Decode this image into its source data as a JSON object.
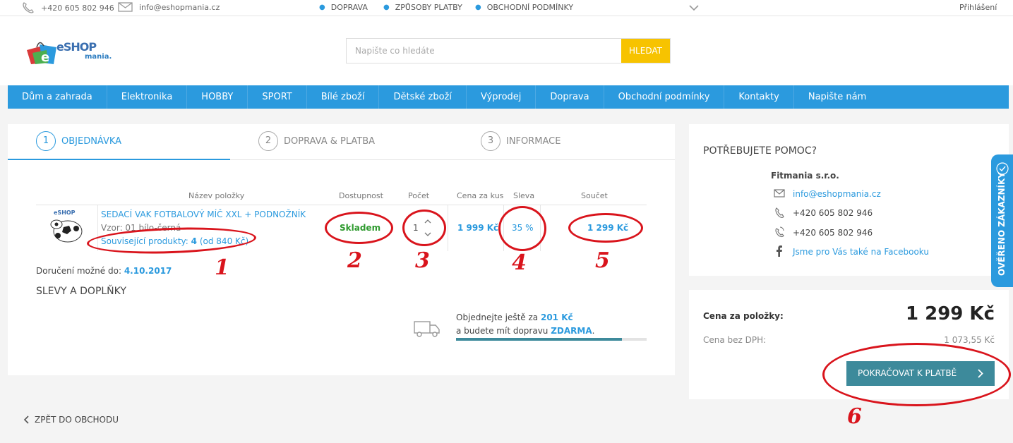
{
  "topbar": {
    "phone": "+420 605 802 946",
    "email": "info@eshopmania.cz",
    "nav": [
      "DOPRAVA",
      "ZPŮSOBY PLATBY",
      "OBCHODNÍ PODMÍNKY"
    ],
    "login": "Přihlášení"
  },
  "logo": {
    "text": "eSHOP",
    "sub": "mania."
  },
  "search": {
    "placeholder": "Napište co hledáte",
    "button": "HLEDAT"
  },
  "menu": [
    "Dům a zahrada",
    "Elektronika",
    "HOBBY",
    "SPORT",
    "Bílé zboží",
    "Dětské zboží",
    "Výprodej",
    "Doprava",
    "Obchodní podmínky",
    "Kontakty",
    "Napište nám"
  ],
  "steps": [
    {
      "n": "1",
      "label": "OBJEDNÁVKA"
    },
    {
      "n": "2",
      "label": "DOPRAVA & PLATBA"
    },
    {
      "n": "3",
      "label": "INFORMACE"
    }
  ],
  "table": {
    "headers": {
      "name": "Název položky",
      "availability": "Dostupnost",
      "count": "Počet",
      "unit_price": "Cena za kus",
      "discount": "Sleva",
      "total": "Součet"
    },
    "item": {
      "name": "SEDACÍ VAK FOTBALOVÝ MÍČ XXL + PODNOŽNÍK",
      "variant": "Vzor: 01 bílo-černá",
      "related_label": "Související produkty:",
      "related_count": "4",
      "related_from": "(od 840 Kč)",
      "availability": "Skladem",
      "quantity": "1",
      "unit_price": "1 999 Kč",
      "discount": "35 %",
      "total": "1 299 Kč"
    }
  },
  "delivery": {
    "label": "Doručení možné do:",
    "date": "4.10.2017"
  },
  "discounts_heading": "SLEVY A DOPLŇKY",
  "shipping": {
    "line1_a": "Objednejte ještě za",
    "amount": "201 Kč",
    "line2_a": "a budete mít dopravu",
    "free": "ZDARMA",
    "line2_end": ".",
    "progress": 0.87
  },
  "back_link": "ZPĚT DO OBCHODU",
  "help": {
    "title": "POTŘEBUJETE POMOC?",
    "company": "Fitmania s.r.o.",
    "email": "info@eshopmania.cz",
    "phone1": "+420 605 802 946",
    "phone2": "+420 605 802 946",
    "facebook": "Jsme pro Vás také na Facebooku"
  },
  "summary": {
    "label": "Cena za položky:",
    "price": "1 299 Kč",
    "vat_label": "Cena bez DPH:",
    "vat_price": "1 073,55 Kč",
    "continue": "POKRAČOVAT K PLATBĚ"
  },
  "badge": "OVĚŘENO ZÁKAZNÍKY",
  "annotations": [
    "1",
    "2",
    "3",
    "4",
    "5",
    "6"
  ],
  "colors": {
    "accent": "#2b9ade",
    "yellow": "#f7c300",
    "button": "#3d8a9b",
    "annotation": "#d9141c",
    "stock": "#2e9a2e"
  }
}
